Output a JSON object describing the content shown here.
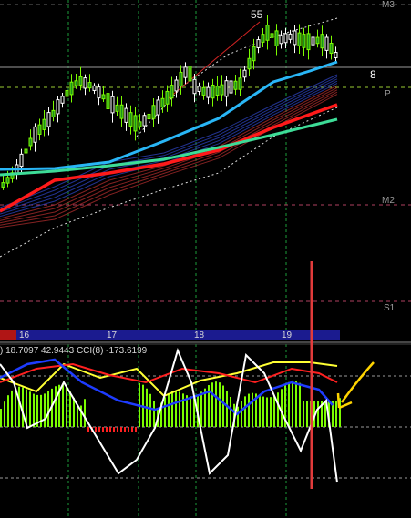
{
  "price_chart": {
    "level_labels": {
      "m3": "M3",
      "p": "P",
      "m2": "M2",
      "s1": "S1"
    },
    "wave_label": "55",
    "price_marker": "8",
    "date_labels": [
      "16",
      "17",
      "18",
      "19"
    ]
  },
  "indicator": {
    "legend": ") 18.7097 42.9443  CCI(8) -173.6199"
  },
  "colors": {
    "background": "#000000",
    "bull_candle": "#7cfc00",
    "bear_candle": "#ffffff",
    "ma_blue": "#29b6f6",
    "ma_red": "#ff1a1a",
    "ma_teal": "#3ddc97",
    "cci": "#ffffff",
    "annotation_arrow": "#ffd400",
    "annotation_vline": "#e23b3b"
  }
}
